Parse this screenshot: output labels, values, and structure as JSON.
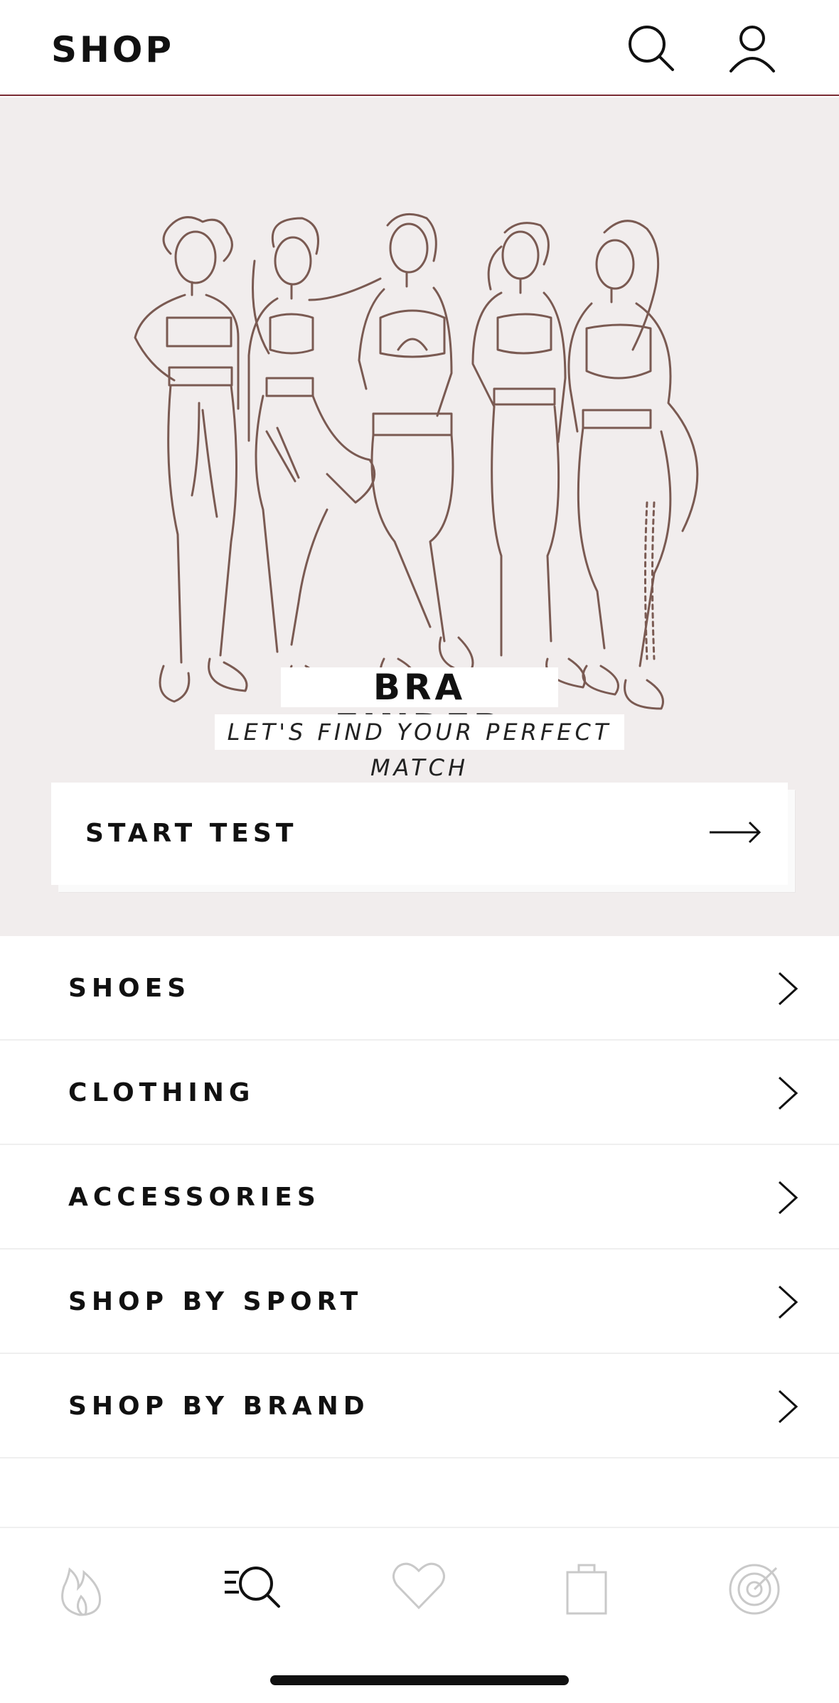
{
  "header": {
    "title": "SHOP",
    "search_icon": "search-icon",
    "account_icon": "user-icon"
  },
  "hero": {
    "title": "BRA FINDER",
    "subtitle": "LET'S FIND YOUR PERFECT MATCH",
    "illustration": "five-women-sportswear-line-drawing",
    "cta_label": "START TEST",
    "cta_icon": "arrow-right-icon"
  },
  "categories": [
    {
      "label": "SHOES"
    },
    {
      "label": "CLOTHING"
    },
    {
      "label": "ACCESSORIES"
    },
    {
      "label": "SHOP BY SPORT"
    },
    {
      "label": "SHOP BY BRAND"
    }
  ],
  "bottom_nav": {
    "items": [
      "flame-icon",
      "search-list-icon",
      "heart-icon",
      "shopping-bag-icon",
      "radar-icon"
    ],
    "active": "search-list-icon"
  },
  "colors": {
    "accent_line": "#7a2b33",
    "hero_bg": "#f1eded",
    "illustration_stroke": "#7a5a52"
  }
}
